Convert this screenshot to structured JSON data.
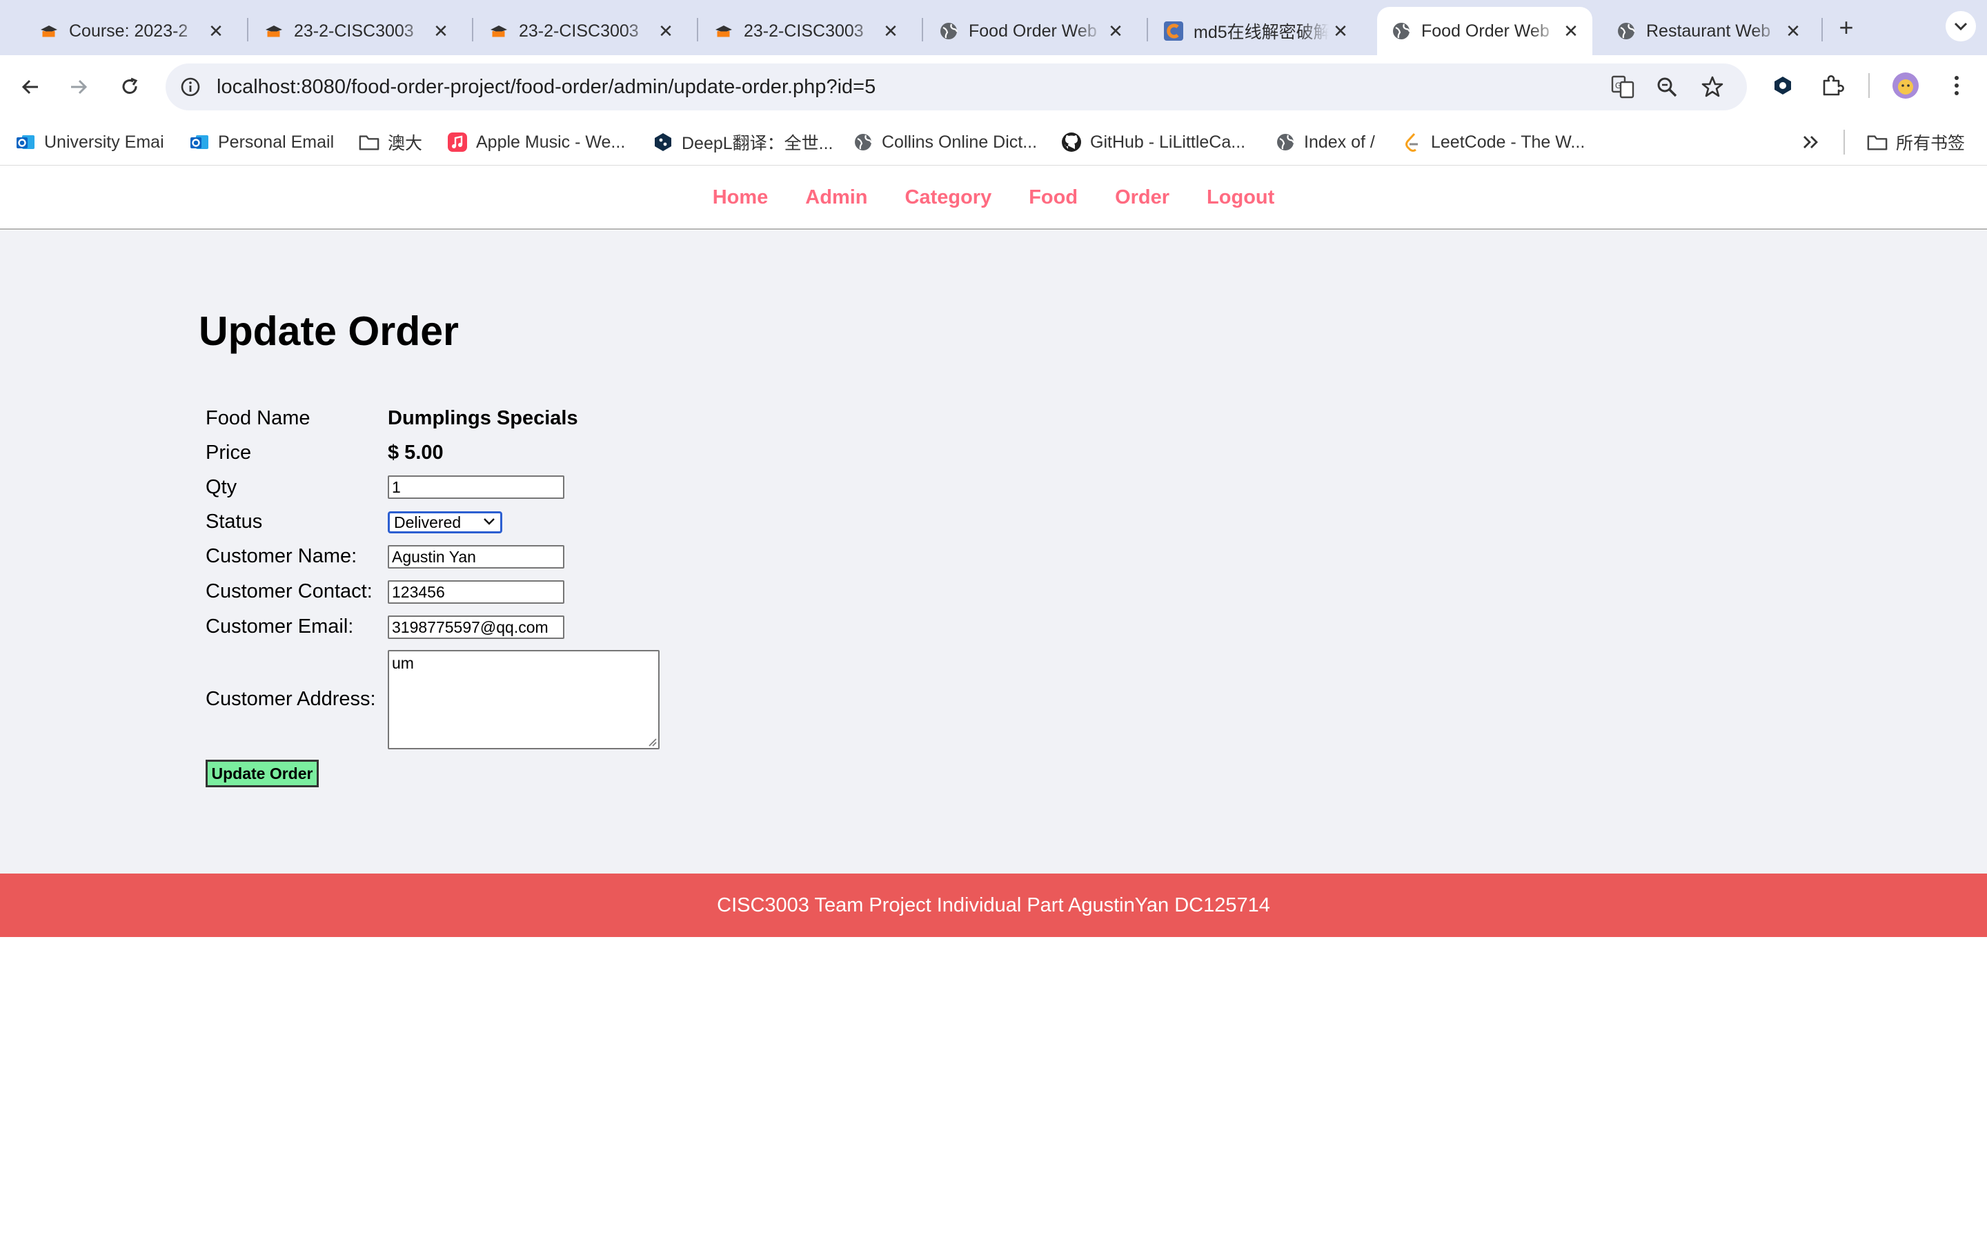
{
  "browser": {
    "tabs": [
      {
        "title": "Course: 2023-2",
        "icon": "moodle-icon"
      },
      {
        "title": "23-2-CISC3003",
        "icon": "moodle-icon"
      },
      {
        "title": "23-2-CISC3003",
        "icon": "moodle-icon"
      },
      {
        "title": "23-2-CISC3003",
        "icon": "moodle-icon"
      },
      {
        "title": "Food Order Web",
        "icon": "globe-icon"
      },
      {
        "title": "md5在线解密破解",
        "icon": "cmd5-icon"
      },
      {
        "title": "Food Order Web",
        "icon": "globe-icon",
        "active": true
      },
      {
        "title": "Restaurant Web",
        "icon": "globe-icon"
      }
    ],
    "url": "localhost:8080/food-order-project/food-order/admin/update-order.php?id=5",
    "bookmarks": [
      {
        "label": "University Emai",
        "icon": "outlook-icon"
      },
      {
        "label": "Personal Email",
        "icon": "outlook-icon"
      },
      {
        "label": "澳大",
        "icon": "folder-icon"
      },
      {
        "label": "Apple Music - We...",
        "icon": "music-icon"
      },
      {
        "label": "DeepL翻译：全世...",
        "icon": "deepl-icon"
      },
      {
        "label": "Collins Online Dict...",
        "icon": "globe-icon"
      },
      {
        "label": "GitHub - LiLittleCa...",
        "icon": "github-icon"
      },
      {
        "label": "Index of /",
        "icon": "globe-icon"
      },
      {
        "label": "LeetCode - The W...",
        "icon": "leetcode-icon"
      }
    ],
    "all_bookmarks_label": "所有书签"
  },
  "nav": {
    "home": "Home",
    "admin": "Admin",
    "category": "Category",
    "food": "Food",
    "order": "Order",
    "logout": "Logout"
  },
  "form": {
    "title": "Update Order",
    "food_name_label": "Food Name",
    "food_name_value": "Dumplings Specials",
    "price_label": "Price",
    "price_value": "$ 5.00",
    "qty_label": "Qty",
    "qty_value": "1",
    "status_label": "Status",
    "status_value": "Delivered",
    "customer_name_label": "Customer Name:",
    "customer_name_value": "Agustin Yan",
    "customer_contact_label": "Customer Contact:",
    "customer_contact_value": "123456",
    "customer_email_label": "Customer Email:",
    "customer_email_value": "3198775597@qq.com",
    "customer_address_label": "Customer Address:",
    "customer_address_value": "um",
    "submit_label": "Update Order"
  },
  "footer": {
    "text": "CISC3003 Team Project Individual Part AgustinYan DC125714"
  },
  "colors": {
    "nav_link": "#ff6b81",
    "footer_bg": "#ea5959",
    "submit_bg": "#7bed9f",
    "content_bg": "#f1f2f6"
  }
}
